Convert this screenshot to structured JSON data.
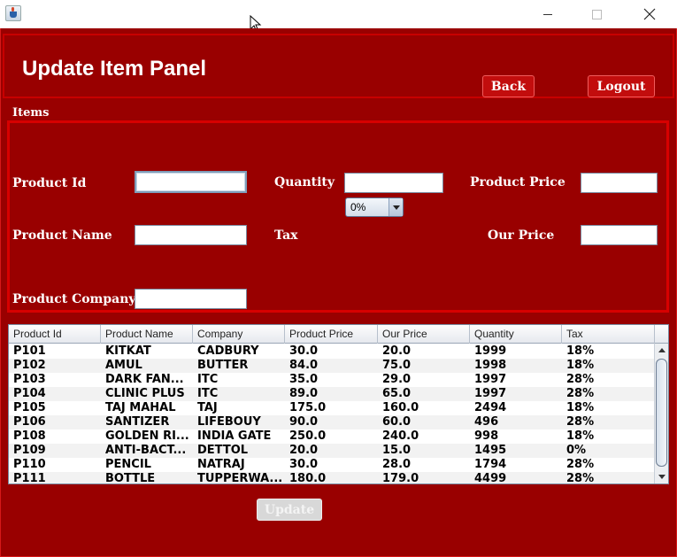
{
  "window": {
    "title_icon": "java-cup-icon"
  },
  "header": {
    "title": "Update Item Panel",
    "back_label": "Back",
    "logout_label": "Logout"
  },
  "items": {
    "section_label": "Items",
    "product_id_label": "Product Id",
    "product_id_value": "",
    "quantity_label": "Quantity",
    "quantity_value": "",
    "product_price_label": "Product Price",
    "product_price_value": "",
    "product_name_label": "Product Name",
    "product_name_value": "",
    "tax_label": "Tax",
    "tax_value": "0%",
    "our_price_label": "Our Price",
    "our_price_value": "",
    "product_company_label": "Product Company",
    "product_company_value": ""
  },
  "table": {
    "columns": [
      "Product Id",
      "Product Name",
      "Company",
      "Product Price",
      "Our Price",
      "Quantity",
      "Tax"
    ],
    "rows": [
      [
        "P101",
        "KITKAT",
        "CADBURY",
        "30.0",
        "20.0",
        "1999",
        "18%"
      ],
      [
        "P102",
        "AMUL",
        "BUTTER",
        "84.0",
        "75.0",
        "1998",
        "18%"
      ],
      [
        "P103",
        "DARK FAN...",
        "ITC",
        "35.0",
        "29.0",
        "1997",
        "28%"
      ],
      [
        "P104",
        "CLINIC PLUS",
        "ITC",
        "89.0",
        "65.0",
        "1997",
        "28%"
      ],
      [
        "P105",
        "TAJ MAHAL",
        "TAJ",
        "175.0",
        "160.0",
        "2494",
        "18%"
      ],
      [
        "P106",
        "SANTIZER",
        "LIFEBOUY",
        "90.0",
        "60.0",
        "496",
        "28%"
      ],
      [
        "P108",
        "GOLDEN RI...",
        "INDIA GATE",
        "250.0",
        "240.0",
        "998",
        "18%"
      ],
      [
        "P109",
        "ANTI-BACT...",
        "DETTOL",
        "20.0",
        "15.0",
        "1495",
        "0%"
      ],
      [
        "P110",
        "PENCIL",
        "NATRAJ",
        "30.0",
        "28.0",
        "1794",
        "28%"
      ],
      [
        "P111",
        "BOTTLE",
        "TUPPERWA...",
        "180.0",
        "179.0",
        "4499",
        "28%"
      ]
    ]
  },
  "footer": {
    "update_label": "Update"
  }
}
